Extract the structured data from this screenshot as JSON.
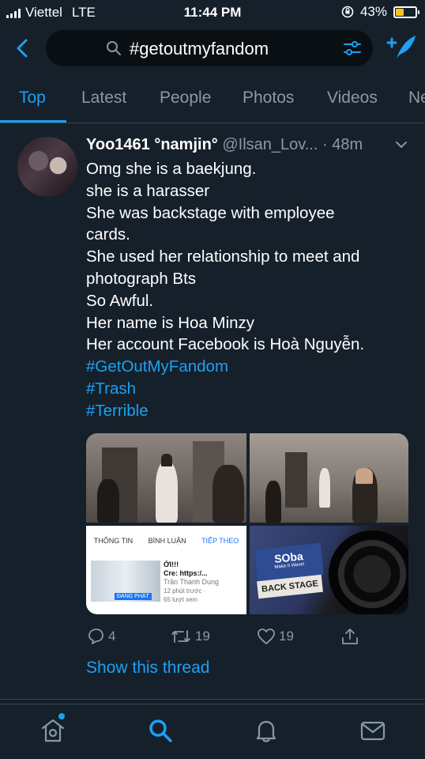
{
  "status_bar": {
    "carrier": "Viettel",
    "network": "LTE",
    "time": "11:44 PM",
    "battery_percent": "43%",
    "battery_level": 0.43
  },
  "search": {
    "query": "#getoutmyfandom"
  },
  "tabs": [
    {
      "label": "Top",
      "active": true
    },
    {
      "label": "Latest",
      "active": false
    },
    {
      "label": "People",
      "active": false
    },
    {
      "label": "Photos",
      "active": false
    },
    {
      "label": "Videos",
      "active": false
    },
    {
      "label": "Ne",
      "active": false
    }
  ],
  "tweet": {
    "display_name": "Yoo1461 °namjin°",
    "handle": "@Ilsan_Lov...",
    "time": "· 48m",
    "lines": [
      "Omg she is a baekjung.",
      "she is a harasser",
      "She was backstage with employee",
      "cards.",
      "She used her relationship to meet and",
      "photograph Bts",
      "So Awful.",
      "Her name is Hoa Minzy",
      "Her account Facebook is Hoà Nguyễn."
    ],
    "hashtags": [
      "#GetOutMyFandom",
      "#Trash",
      "#Terrible"
    ],
    "media": {
      "photo3": {
        "tabs": [
          "THÔNG TIN",
          "BÌNH LUẬN",
          "TIẾP THEO"
        ],
        "post_title": "ỚI!!!",
        "post_line": "Cre: https:/...",
        "post_author": "Trần Thanh Dung",
        "post_time": "12 phút trước ·",
        "post_views": "65 lượt xem",
        "live_badge": "ĐANG PHÁT"
      },
      "photo4": {
        "sign_text": "SOba",
        "sign_sub": "Make It Wave!",
        "backstage_text": "BACK STAGE"
      }
    },
    "reply_count": "4",
    "retweet_count": "19",
    "like_count": "19",
    "show_thread": "Show this thread"
  },
  "colors": {
    "background": "#15202b",
    "accent": "#1da1f2",
    "muted": "#8899a6",
    "divider": "#38444d",
    "battery": "#f5c518"
  },
  "icons": {
    "back": "chevron-left-icon",
    "search": "search-icon",
    "filter": "sliders-icon",
    "compose": "compose-tweet-icon",
    "reply": "reply-icon",
    "retweet": "retweet-icon",
    "like": "heart-icon",
    "share": "share-icon",
    "home": "home-icon",
    "explore": "search-icon",
    "notifications": "bell-icon",
    "messages": "mail-icon"
  }
}
